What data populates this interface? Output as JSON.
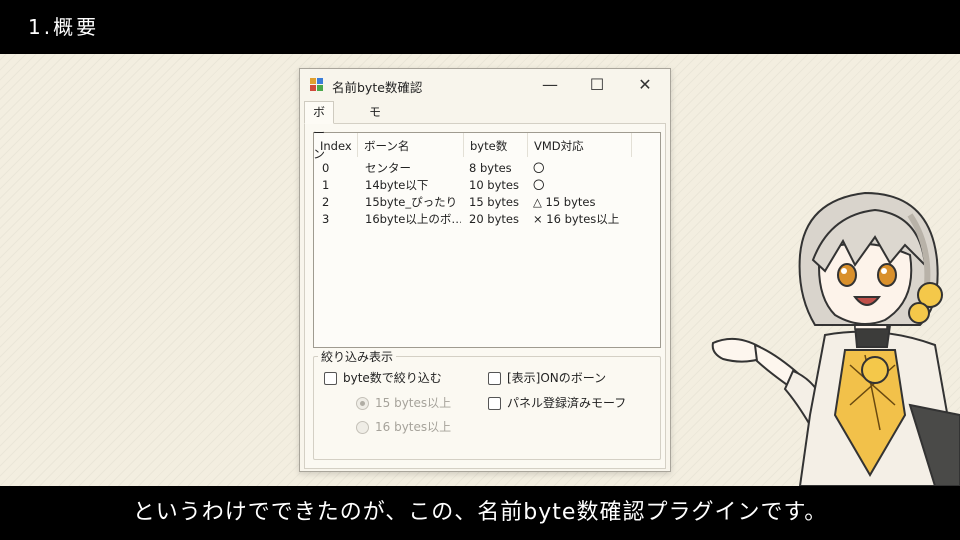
{
  "slide": {
    "heading": "1.概要",
    "subtitle": "というわけでできたのが、この、名前byte数確認プラグインです。"
  },
  "window": {
    "title": "名前byte数確認",
    "controls": {
      "minimize": "—",
      "maximize": "☐",
      "close": "✕"
    },
    "tabs": [
      {
        "label": "ボーン",
        "active": true
      },
      {
        "label": "モーフ",
        "active": false
      }
    ],
    "list": {
      "columns": [
        "Index",
        "ボーン名",
        "byte数",
        "VMD対応"
      ],
      "rows": [
        {
          "index": "0",
          "name": "センター",
          "bytes": "8 bytes",
          "vmd": "〇"
        },
        {
          "index": "1",
          "name": "14byte以下",
          "bytes": "10 bytes",
          "vmd": "〇"
        },
        {
          "index": "2",
          "name": "15byte_ぴったり",
          "bytes": "15 bytes",
          "vmd": "△ 15 bytes"
        },
        {
          "index": "3",
          "name": "16byte以上のボ…",
          "bytes": "20 bytes",
          "vmd": "× 16 bytes以上"
        }
      ]
    },
    "filter": {
      "title": "絞り込み表示",
      "byte_filter": {
        "label": "byte数で絞り込む",
        "checked": false
      },
      "radio_15": {
        "label": "15 bytes以上",
        "selected": true,
        "enabled": false
      },
      "radio_16": {
        "label": "16 bytes以上",
        "selected": false,
        "enabled": false
      },
      "visible_bones": {
        "label": "[表示]ONのボーン",
        "checked": false
      },
      "panel_morphs": {
        "label": "パネル登録済みモーフ",
        "checked": false
      }
    }
  }
}
